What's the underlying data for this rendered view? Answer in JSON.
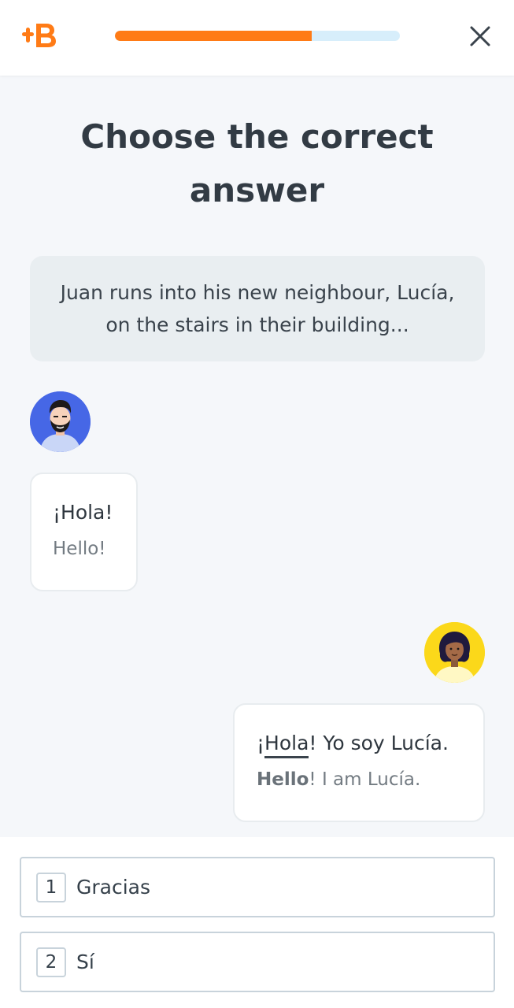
{
  "header": {
    "logo_text": "+B",
    "progress_fraction": 0.69,
    "accent_color": "#ff7b16",
    "track_color": "#d7eefb",
    "close_icon": "close-icon"
  },
  "title": "Choose the correct answer",
  "context": "Juan runs into his new neighbour, Lucía, on the stairs in their building...",
  "dialogue": [
    {
      "speaker": "juan",
      "avatar_icon": "man-avatar-icon",
      "avatar_color": "#4667e6",
      "es": "¡Hola!",
      "en": "Hello!"
    },
    {
      "speaker": "lucia",
      "avatar_icon": "woman-avatar-icon",
      "avatar_color": "#fbd81a",
      "es_prefix": "¡",
      "es_highlight": "Hola",
      "es_rest": "! Yo soy Lucía.",
      "en_bold": "Hello",
      "en_rest": "! I am Lucía."
    }
  ],
  "options": [
    {
      "number": "1",
      "label": "Gracias"
    },
    {
      "number": "2",
      "label": "Sí"
    }
  ]
}
